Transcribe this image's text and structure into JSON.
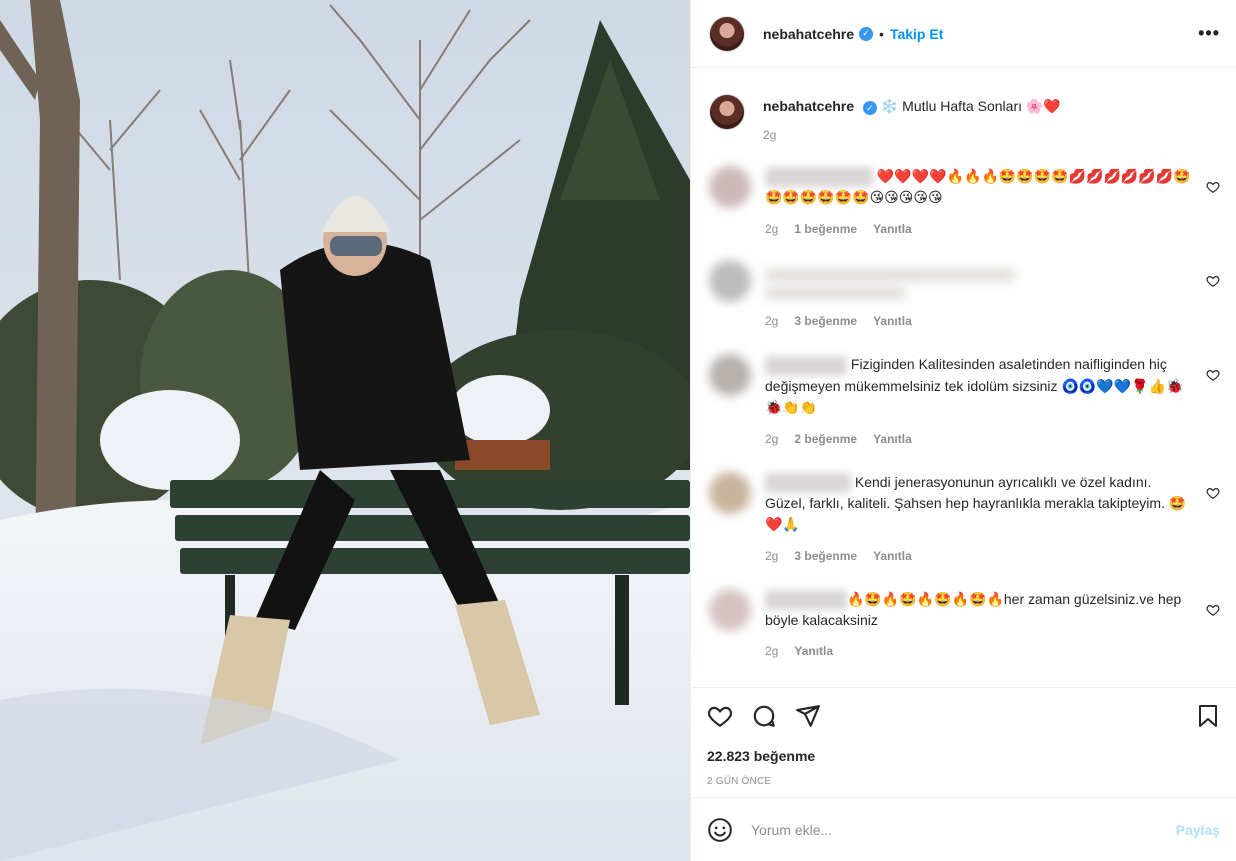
{
  "post": {
    "username": "nebahatcehre",
    "follow_label": "Takip Et",
    "more_label": "•••",
    "caption_text": "Mutlu Hafta Sonları",
    "caption_emoji_start": "❄️",
    "caption_emoji_end": "🌸❤️",
    "caption_time": "2g"
  },
  "comments": [
    {
      "text": "",
      "emojis": "❤️❤️❤️❤️🔥🔥🔥🤩🤩🤩🤩💋💋💋💋💋💋🤩🤩🤩🤩🤩🤩🤩😘😘😘😘😘",
      "time": "2g",
      "likes": "1 beğenme",
      "reply": "Yanıtla"
    },
    {
      "text": "",
      "emojis": "",
      "time": "2g",
      "likes": "3 beğenme",
      "reply": "Yanıtla"
    },
    {
      "text": "Fiziginden Kalitesinden asaletinden naifliginden hiç değişmeyen mükemmelsiniz tek idolüm sizsiniz",
      "emojis": "🧿🧿💙💙🌹👍🐞🐞👏👏",
      "time": "2g",
      "likes": "2 beğenme",
      "reply": "Yanıtla"
    },
    {
      "text": "Kendi jenerasyonunun ayrıcalıklı ve özel kadını. Güzel, farklı, kaliteli. Şahsen hep hayranlıkla merakla takipteyim.",
      "emojis": "🤩❤️🙏",
      "time": "2g",
      "likes": "3 beğenme",
      "reply": "Yanıtla"
    },
    {
      "text": "her zaman güzelsiniz.ve hep böyle kalacaksiniz",
      "emojis": "🔥🤩🔥🤩🔥🤩🔥🤩🔥",
      "time": "2g",
      "likes": "",
      "reply": "Yanıtla"
    }
  ],
  "footer": {
    "likes_count": "22.823 beğenme",
    "date": "2 GÜN ÖNCE",
    "comment_placeholder": "Yorum ekle...",
    "share_label": "Paylaş"
  },
  "colors": {
    "link_blue": "#0095f6",
    "share_disabled": "#b2dffc",
    "muted": "#8e8e8e",
    "verified": "#3897f0"
  },
  "icons": [
    "verified-badge-icon",
    "more-icon",
    "heart-icon",
    "comment-icon",
    "share-icon",
    "bookmark-icon",
    "emoji-icon"
  ]
}
